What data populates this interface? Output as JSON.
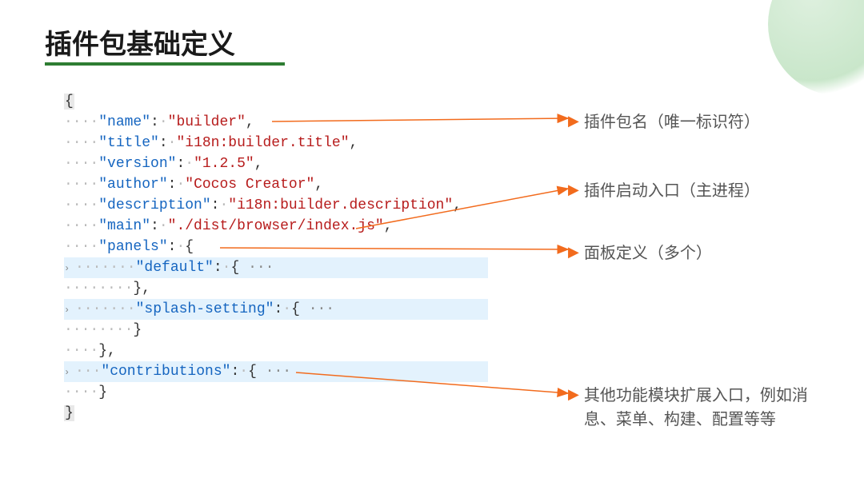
{
  "title": "插件包基础定义",
  "code": {
    "open_brace": "{",
    "name_key": "\"name\"",
    "name_val": "\"builder\"",
    "title_key": "\"title\"",
    "title_val": "\"i18n:builder.title\"",
    "version_key": "\"version\"",
    "version_val": "\"1.2.5\"",
    "author_key": "\"author\"",
    "author_val": "\"Cocos Creator\"",
    "desc_key": "\"description\"",
    "desc_val": "\"i18n:builder.description\"",
    "main_key": "\"main\"",
    "main_val": "\"./dist/browser/index.js\"",
    "panels_key": "\"panels\"",
    "default_key": "\"default\"",
    "splash_key": "\"splash-setting\"",
    "contrib_key": "\"contributions\"",
    "close_brace": "}",
    "close_brace_inner": "}",
    "close_panel": "},",
    "colon_space": ": ",
    "comma": ",",
    "open_obj": "{",
    "fold_ellipsis": " ···"
  },
  "annotations": {
    "a1": "插件包名（唯一标识符）",
    "a2": "插件启动入口（主进程）",
    "a3": "面板定义（多个）",
    "a4": "其他功能模块扩展入口，例如消息、菜单、构建、配置等等"
  }
}
